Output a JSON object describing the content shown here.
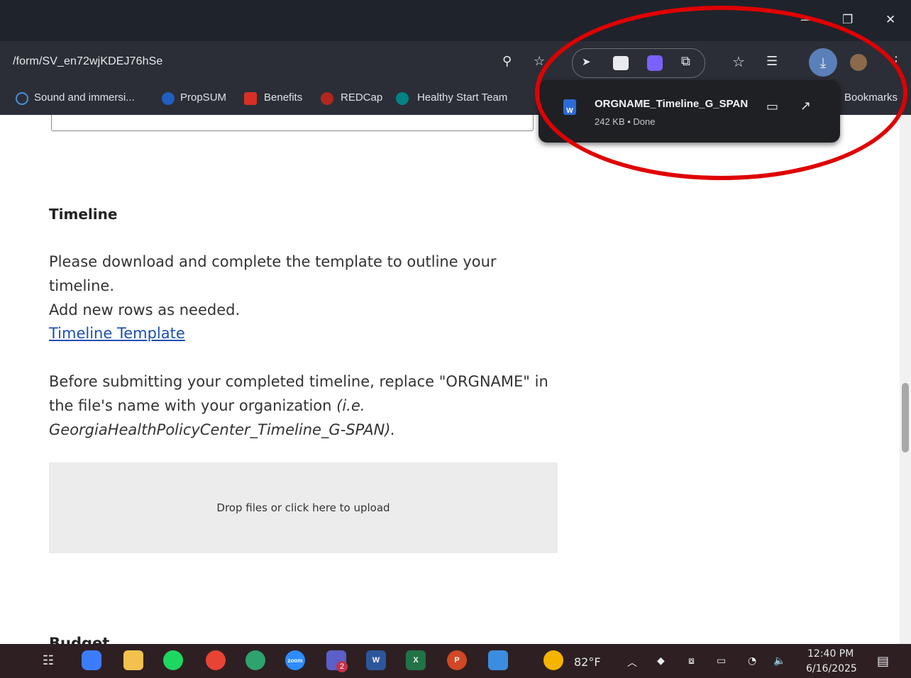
{
  "window": {
    "minimize": "—",
    "restore": "❐",
    "close": "✕"
  },
  "address_bar": {
    "url": "/form/SV_en72wjKDEJ76hSe"
  },
  "toolbar_icons": [
    "zoom-icon",
    "star-icon",
    "pointer-extension-icon",
    "glasses-extension-icon",
    "shield-extension-icon",
    "puzzle-extension-icon",
    "favorites-icon",
    "reading-list-icon",
    "download-icon",
    "profile-avatar",
    "menu-icon"
  ],
  "bookmarks": [
    {
      "label": "Sound and immersi...",
      "color": "#4a90d9"
    },
    {
      "label": "PropSUM",
      "color": "#1f5fbf"
    },
    {
      "label": "Benefits",
      "color": "#d93025"
    },
    {
      "label": "REDCap",
      "color": "#b3261e"
    },
    {
      "label": "Healthy Start Team",
      "color": "#038387"
    }
  ],
  "bookmarks_overflow": "Bookmarks",
  "download_popup": {
    "filename": "ORGNAME_Timeline_G_SPAN",
    "status": "242 KB • Done",
    "file_icon_label": "W"
  },
  "page": {
    "heading": "Timeline",
    "para1_line1": "Please download and complete the template to outline your timeline.",
    "para1_line2": "Add new rows as needed.",
    "link": "Timeline Template",
    "para2_line1": "Before submitting your completed timeline, replace \"ORGNAME\" in",
    "para2_line2_plain": "the file's name with your organization ",
    "para2_line2_italic": "(i.e.",
    "para2_line3": "GeorgiaHealthPolicyCenter_Timeline_G-SPAN).",
    "dropzone": "Drop files or click here to upload",
    "next_heading_partial": "Budget"
  },
  "taskbar": {
    "apps": [
      "task-view",
      "copilot",
      "file-explorer",
      "spotify",
      "chrome",
      "edge",
      "zoom",
      "teams",
      "word",
      "excel",
      "powerpoint",
      "photos"
    ],
    "teams_badge": "2",
    "zoom_label": "zoom",
    "weather": "82°F",
    "time": "12:40 PM",
    "date": "6/16/2025"
  }
}
